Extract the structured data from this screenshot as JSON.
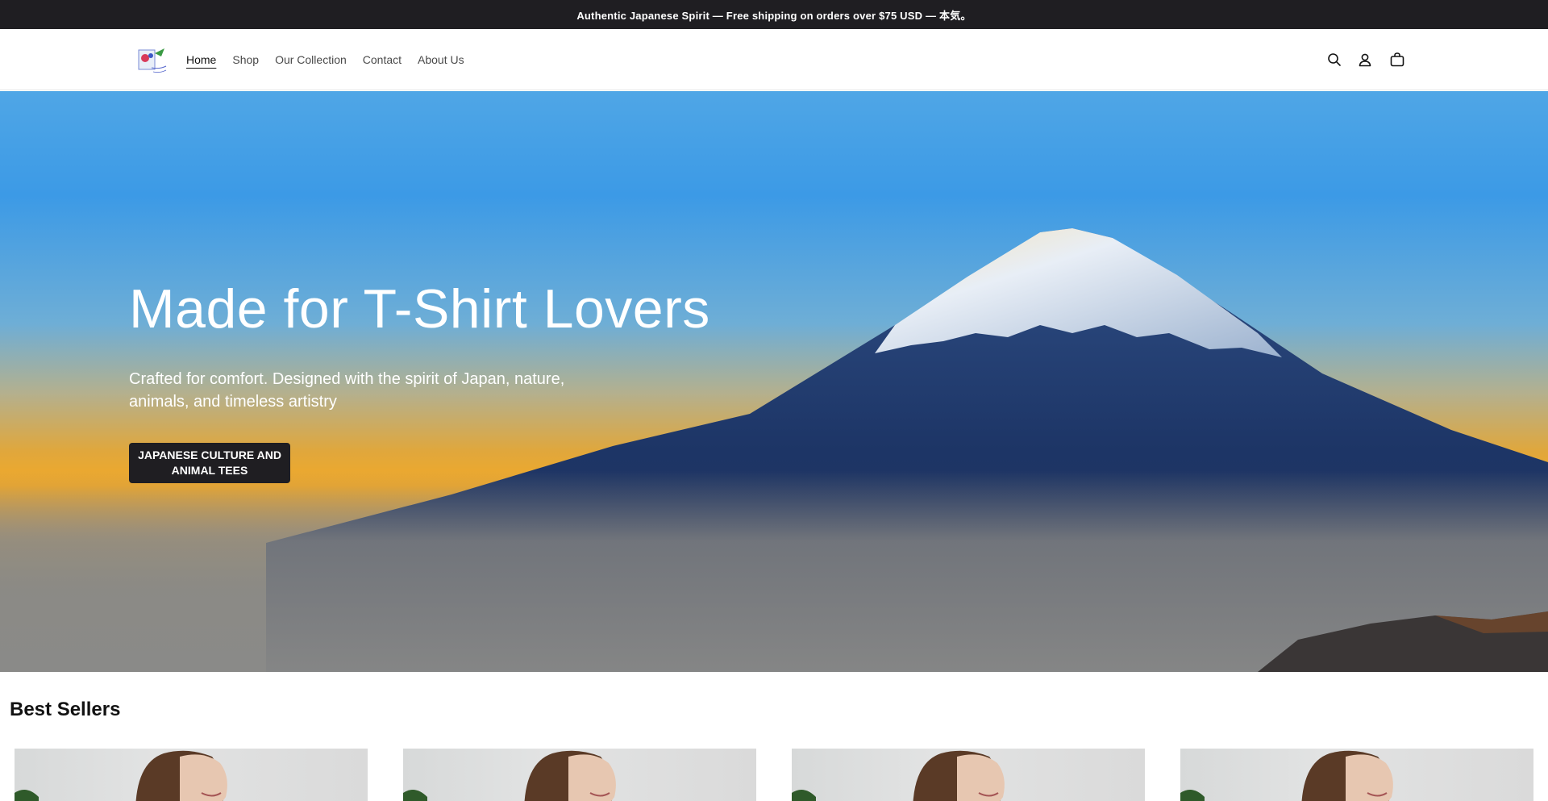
{
  "announcement": {
    "text": "Authentic Japanese Spirit — Free shipping on orders over $75 USD — 本気。"
  },
  "header": {
    "logo_icon": "store-logo",
    "nav": [
      {
        "label": "Home",
        "active": true
      },
      {
        "label": "Shop",
        "active": false
      },
      {
        "label": "Our Collection",
        "active": false
      },
      {
        "label": "Contact",
        "active": false
      },
      {
        "label": "About Us",
        "active": false
      }
    ],
    "icons": [
      "search-icon",
      "account-icon",
      "cart-icon"
    ]
  },
  "hero": {
    "title": "Made for T-Shirt Lovers",
    "subtitle": "Crafted for comfort. Designed with the spirit of Japan, nature, animals, and timeless artistry",
    "button_label": "JAPANESE CULTURE AND ANIMAL TEES"
  },
  "best_sellers": {
    "title": "Best Sellers",
    "products": [
      {
        "image": "model-wearing-tee"
      },
      {
        "image": "model-wearing-tee"
      },
      {
        "image": "model-wearing-tee"
      },
      {
        "image": "model-wearing-tee"
      }
    ]
  },
  "colors": {
    "announcement_bg": "#1f1e22",
    "button_bg": "#1f1e22",
    "text_dark": "#121212"
  }
}
